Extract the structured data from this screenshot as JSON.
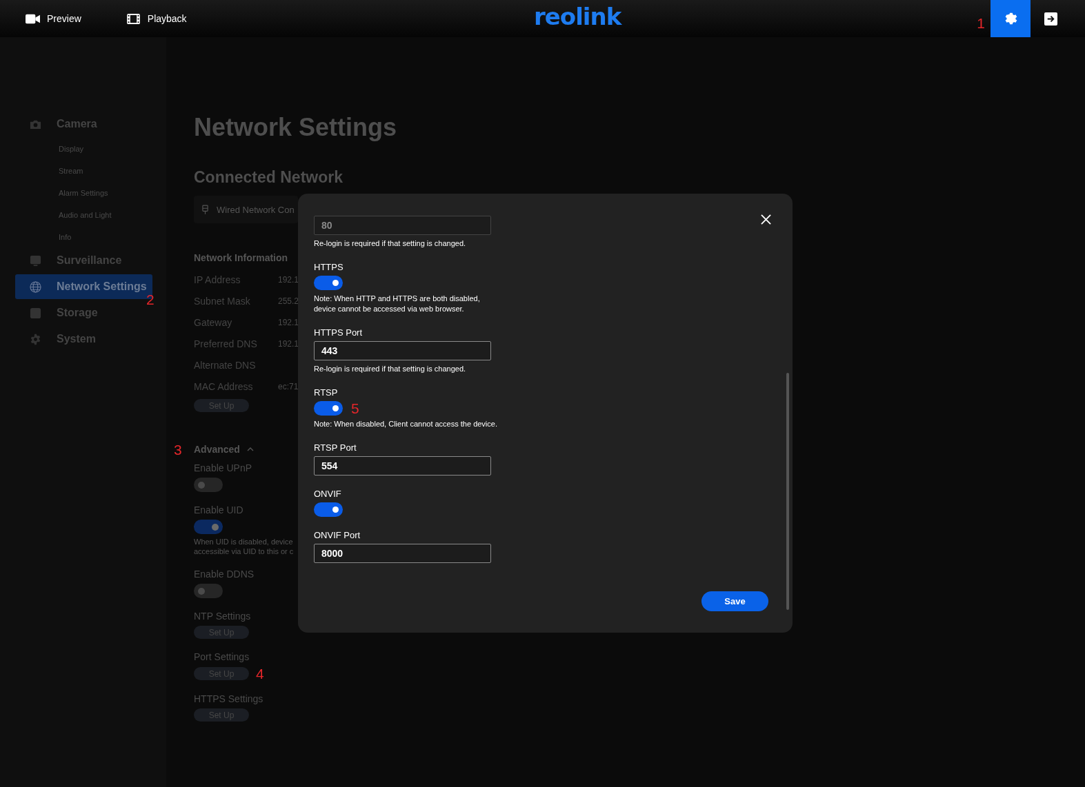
{
  "header": {
    "nav": [
      {
        "label": "Preview"
      },
      {
        "label": "Playback"
      }
    ],
    "logo": "reolink",
    "annotation": "1"
  },
  "sidebar": {
    "items": [
      {
        "label": "Camera",
        "selected": false,
        "children": [
          {
            "label": "Display"
          },
          {
            "label": "Stream"
          },
          {
            "label": "Alarm Settings"
          },
          {
            "label": "Audio and Light"
          },
          {
            "label": "Info"
          }
        ]
      },
      {
        "label": "Surveillance",
        "selected": false
      },
      {
        "label": "Network Settings",
        "selected": true,
        "annotation": "2"
      },
      {
        "label": "Storage",
        "selected": false
      },
      {
        "label": "System",
        "selected": false
      }
    ]
  },
  "main": {
    "title": "Network Settings",
    "section": "Connected Network",
    "connection": "Wired Network Con",
    "info": {
      "heading": "Network Information",
      "rows": [
        {
          "label": "IP Address",
          "value": "192.1"
        },
        {
          "label": "Subnet Mask",
          "value": "255.2"
        },
        {
          "label": "Gateway",
          "value": "192.1"
        },
        {
          "label": "Preferred DNS",
          "value": "192.1"
        },
        {
          "label": "Alternate DNS"
        },
        {
          "label": "MAC Address",
          "value": "ec:71"
        }
      ],
      "button": "Set Up"
    },
    "advanced": {
      "heading": "Advanced",
      "expanded": true,
      "annotation": "3",
      "items": [
        {
          "kind": "toggle",
          "label": "Enable UPnP",
          "on": false
        },
        {
          "kind": "toggle",
          "label": "Enable UID",
          "on": true,
          "note": [
            "When UID is disabled, device",
            "accessible via UID to this or c"
          ]
        },
        {
          "kind": "toggle",
          "label": "Enable DDNS",
          "on": false
        },
        {
          "kind": "button",
          "label": "NTP Settings",
          "button": "Set Up"
        },
        {
          "kind": "button",
          "label": "Port Settings",
          "button": "Set Up",
          "annotation": "4"
        },
        {
          "kind": "button",
          "label": "HTTPS Settings",
          "button": "Set Up"
        }
      ]
    }
  },
  "dialog": {
    "items": [
      {
        "kind": "field",
        "value": "80",
        "disabled": true,
        "note": "Re-login is required if that setting is changed."
      },
      {
        "kind": "toggle",
        "label": "HTTPS",
        "on": true,
        "note": "Note: When HTTP and HTTPS are both disabled, device cannot be accessed via web browser."
      },
      {
        "kind": "field",
        "label": "HTTPS Port",
        "value": "443",
        "disabled": false,
        "note": "Re-login is required if that setting is changed."
      },
      {
        "kind": "toggle",
        "label": "RTSP",
        "on": true,
        "annotation": "5",
        "note": "Note: When disabled, Client cannot access the device."
      },
      {
        "kind": "field",
        "label": "RTSP Port",
        "value": "554",
        "disabled": false
      },
      {
        "kind": "toggle",
        "label": "ONVIF",
        "on": true
      },
      {
        "kind": "field",
        "label": "ONVIF Port",
        "value": "8000",
        "disabled": false
      }
    ],
    "save": "Save"
  }
}
